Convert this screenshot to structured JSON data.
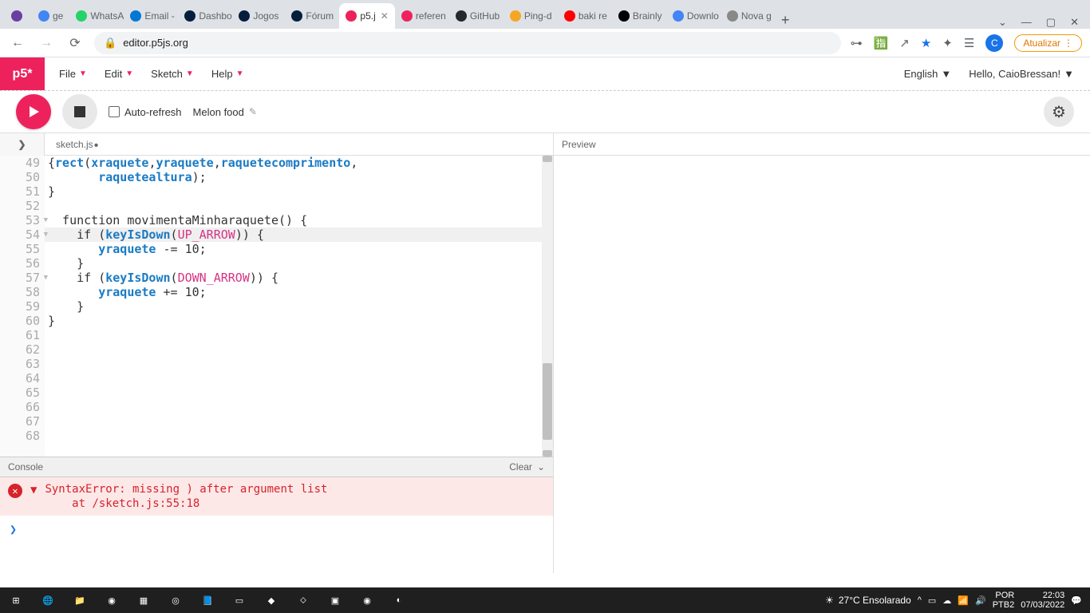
{
  "browser": {
    "tabs": [
      {
        "label": "",
        "fav": "#6b3fa0"
      },
      {
        "label": "ge",
        "fav": "#4285f4"
      },
      {
        "label": "WhatsA",
        "fav": "#25d366"
      },
      {
        "label": "Email -",
        "fav": "#0078d4"
      },
      {
        "label": "Dashbo",
        "fav": "#051e3e"
      },
      {
        "label": "Jogos",
        "fav": "#051e3e"
      },
      {
        "label": "Fórum",
        "fav": "#051e3e"
      },
      {
        "label": "p5.j",
        "fav": "#ed225d",
        "active": true
      },
      {
        "label": "referen",
        "fav": "#ed225d"
      },
      {
        "label": "GitHub",
        "fav": "#24292e"
      },
      {
        "label": "Ping-d",
        "fav": "#f5a623"
      },
      {
        "label": "baki re",
        "fav": "#ff0000"
      },
      {
        "label": "Brainly",
        "fav": "#000"
      },
      {
        "label": "Downlo",
        "fav": "#4285f4"
      },
      {
        "label": "Nova g",
        "fav": "#888"
      }
    ],
    "url": "editor.p5js.org",
    "update": "Atualizar",
    "avatar_letter": "C"
  },
  "editor": {
    "logo": "p5*",
    "menus": [
      "File",
      "Edit",
      "Sketch",
      "Help"
    ],
    "lang": "English",
    "greeting": "Hello, CaioBressan!",
    "autorefresh": "Auto-refresh",
    "sketchname": "Melon food",
    "filename": "sketch.js",
    "preview": "Preview",
    "lines": [
      {
        "n": 49,
        "raw": "{rect(xraquete,yraquete,raquetecomprimento,",
        "fold": false
      },
      {
        "n": 50,
        "raw": "       raquetealtura);",
        "fold": false
      },
      {
        "n": 51,
        "raw": "}",
        "fold": false
      },
      {
        "n": 52,
        "raw": "",
        "fold": false
      },
      {
        "n": 53,
        "raw": "  function movimentaMinharaquete() {",
        "fold": true
      },
      {
        "n": 54,
        "raw": "    if (keyIsDown(UP_ARROW)) {",
        "fold": true,
        "hl": true
      },
      {
        "n": 55,
        "raw": "       yraquete -= 10;",
        "fold": false
      },
      {
        "n": 56,
        "raw": "    }",
        "fold": false
      },
      {
        "n": 57,
        "raw": "    if (keyIsDown(DOWN_ARROW)) {",
        "fold": true
      },
      {
        "n": 58,
        "raw": "       yraquete += 10;",
        "fold": false
      },
      {
        "n": 59,
        "raw": "    }",
        "fold": false
      },
      {
        "n": 60,
        "raw": "}",
        "fold": false
      },
      {
        "n": 61,
        "raw": "",
        "fold": false
      },
      {
        "n": 62,
        "raw": "",
        "fold": false
      },
      {
        "n": 63,
        "raw": "",
        "fold": false
      },
      {
        "n": 64,
        "raw": "",
        "fold": false
      },
      {
        "n": 65,
        "raw": "",
        "fold": false
      },
      {
        "n": 66,
        "raw": "",
        "fold": false
      },
      {
        "n": 67,
        "raw": "",
        "fold": false
      },
      {
        "n": 68,
        "raw": "",
        "fold": false
      }
    ],
    "console_label": "Console",
    "clear_label": "Clear",
    "error_msg": "SyntaxError: missing ) after argument list",
    "error_loc": "    at /sketch.js:55:18"
  },
  "taskbar": {
    "weather": "27°C  Ensolarado",
    "lang1": "POR",
    "lang2": "PTB2",
    "time": "22:03",
    "date": "07/03/2022"
  }
}
